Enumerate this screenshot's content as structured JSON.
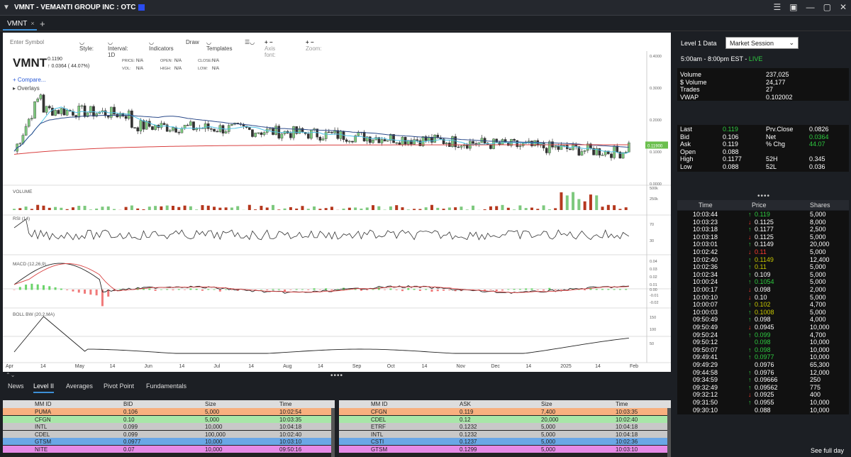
{
  "window": {
    "title": "VMNT - VEMANTI GROUP INC : OTC",
    "swatch_color": "#2a4cf0",
    "controls": [
      "☰",
      "▣",
      "—",
      "▢",
      "✕"
    ]
  },
  "tabs": [
    {
      "label": "VMNT",
      "close": "×"
    }
  ],
  "add_tab": "+",
  "toolbar": {
    "symbol_placeholder": "Enter Symbol",
    "style": "Style:",
    "interval": "Interval: 1D",
    "indicators": "Indicators",
    "draw": "Draw",
    "templates": "Templates",
    "axis_font": "Axis font:",
    "zoom": "Zoom:"
  },
  "quote": {
    "symbol": "VMNT",
    "last": "0.1190",
    "change": "0.0364 ( 44.07%)",
    "fields": [
      {
        "k": "PRICE:",
        "v": "N/A"
      },
      {
        "k": "OPEN:",
        "v": "N/A"
      },
      {
        "k": "CLOSE:",
        "v": "N/A"
      },
      {
        "k": "VOL:",
        "v": "N/A"
      },
      {
        "k": "HIGH:",
        "v": "N/A"
      },
      {
        "k": "LOW:",
        "v": "N/A"
      }
    ],
    "compare": "Compare...",
    "overlays": "Overlays",
    "price_tag": "0.11900"
  },
  "price_axis": [
    "0.4000",
    "0.3000",
    "0.2000",
    "0.1000",
    "0.0000"
  ],
  "panels": [
    {
      "label": "VOLUME",
      "ticks": [
        "500k",
        "250k"
      ]
    },
    {
      "label": "RSI (14)",
      "ticks": [
        "70",
        "30"
      ]
    },
    {
      "label": "MACD (12,26,9)",
      "ticks": [
        "0.04",
        "0.03",
        "0.02",
        "0.01",
        "0.00",
        "-0.01",
        "-0.02"
      ]
    },
    {
      "label": "BOLL BW (20,2,MA)",
      "ticks": [
        "150",
        "100",
        "50"
      ]
    }
  ],
  "x_axis": [
    "Apr",
    "14",
    "May",
    "14",
    "Jun",
    "14",
    "Jul",
    "14",
    "Aug",
    "14",
    "Sep",
    "Oct",
    "14",
    "Nov",
    "Dec",
    "14",
    "2025",
    "14",
    "Feb"
  ],
  "chart_data": {
    "type": "candlestick",
    "symbol": "VMNT",
    "series": [
      "price",
      "ma_short",
      "ma_long",
      "ma_flat",
      "volume",
      "rsi",
      "macd",
      "boll_bw"
    ],
    "y_range": [
      0.0,
      0.4
    ]
  },
  "level1": {
    "label": "Level 1 Data",
    "session_select": "Market Session",
    "hours": "5:00am - 8:00pm EST - ",
    "live": "LIVE",
    "stats": [
      {
        "k": "Volume",
        "v": "237,025"
      },
      {
        "k": "$ Volume",
        "v": "24,177"
      },
      {
        "k": " Trades",
        "v": "27"
      },
      {
        "k": " VWAP",
        "v": "0.102002"
      }
    ],
    "quote_left": [
      {
        "k": "Last",
        "v": "0.119",
        "c": "#2ecc40"
      },
      {
        "k": "Bid",
        "v": "0.106",
        "c": "#fff"
      },
      {
        "k": "Ask",
        "v": "0.119",
        "c": "#fff"
      },
      {
        "k": "Open",
        "v": "0.088",
        "c": "#fff"
      },
      {
        "k": "High",
        "v": "0.1177",
        "c": "#fff"
      },
      {
        "k": "Low",
        "v": "0.088",
        "c": "#fff"
      }
    ],
    "quote_right": [
      {
        "k": "Prv.Close",
        "v": "0.0826",
        "c": "#fff"
      },
      {
        "k": "Net",
        "v": "0.0364",
        "c": "#2ecc40"
      },
      {
        "k": "% Chg",
        "v": "44.07",
        "c": "#2ecc40"
      },
      {
        "k": "",
        "v": "",
        "c": "#fff"
      },
      {
        "k": "52H",
        "v": "0.345",
        "c": "#fff"
      },
      {
        "k": "52L",
        "v": "0.036",
        "c": "#fff"
      }
    ]
  },
  "time_sales": {
    "headers": [
      "Time",
      "Price",
      "Shares"
    ],
    "see_full": "See full day",
    "rows": [
      [
        "10:03:44",
        "↑",
        "0.119",
        "5,000",
        "#2ecc40"
      ],
      [
        "10:03:23",
        "↓",
        "0.1125",
        "8,000",
        "#fff"
      ],
      [
        "10:03:18",
        "↑",
        "0.1177",
        "2,500",
        "#fff"
      ],
      [
        "10:03:18",
        "↓",
        "0.1125",
        "5,000",
        "#fff"
      ],
      [
        "10:03:01",
        "↑",
        "0.1149",
        "20,000",
        "#fff"
      ],
      [
        "10:02:42",
        "↓",
        "0.11",
        "5,000",
        "#ff3b30"
      ],
      [
        "10:02:40",
        "↑",
        "0.1149",
        "12,400",
        "#c8c800"
      ],
      [
        "10:02:36",
        "↑",
        "0.11",
        "5,000",
        "#c8c800"
      ],
      [
        "10:02:34",
        "↑",
        "0.109",
        "5,000",
        "#fff"
      ],
      [
        "10:00:24",
        "↑",
        "0.1054",
        "5,000",
        "#2ecc40"
      ],
      [
        "10:00:17",
        "↓",
        "0.098",
        "2,000",
        "#fff"
      ],
      [
        "10:00:10",
        "↓",
        "0.10",
        "5,000",
        "#fff"
      ],
      [
        "10:00:07",
        "↑",
        "0.102",
        "4,700",
        "#c8c800"
      ],
      [
        "10:00:03",
        "↑",
        "0.1008",
        "5,000",
        "#c8c800"
      ],
      [
        "09:50:49",
        "↑",
        "0.098",
        "4,000",
        "#fff"
      ],
      [
        "09:50:49",
        "↓",
        "0.0945",
        "10,000",
        "#fff"
      ],
      [
        "09:50:24",
        "↑",
        "0.099",
        "4,700",
        "#2ecc40"
      ],
      [
        "09:50:12",
        "",
        "0.098",
        "10,000",
        "#2ecc40"
      ],
      [
        "09:50:07",
        "↑",
        "0.098",
        "10,000",
        "#2ecc40"
      ],
      [
        "09:49:41",
        "↑",
        "0.0977",
        "10,000",
        "#2ecc40"
      ],
      [
        "09:49:29",
        "",
        "0.0976",
        "65,300",
        "#fff"
      ],
      [
        "09:44:58",
        "↑",
        "0.0976",
        "12,000",
        "#fff"
      ],
      [
        "09:34:59",
        "↑",
        "0.09666",
        "250",
        "#fff"
      ],
      [
        "09:32:49",
        "↑",
        "0.09562",
        "775",
        "#fff"
      ],
      [
        "09:32:12",
        "↓",
        "0.0925",
        "400",
        "#fff"
      ],
      [
        "09:31:50",
        "↑",
        "0.0955",
        "10,000",
        "#fff"
      ],
      [
        "09:30:10",
        "",
        "0.088",
        "10,000",
        "#fff"
      ]
    ]
  },
  "bottom_tabs": [
    "News",
    "Level II",
    "Averages",
    "Pivot Point",
    "Fundamentals"
  ],
  "level2_bid": {
    "headers": [
      "MM ID",
      "BID",
      "Size",
      "Time"
    ],
    "rows": [
      [
        "PUMA",
        "0.106",
        "5,000",
        "10:02:54",
        "#f8b07f"
      ],
      [
        "CFGN",
        "0.10",
        "5,000",
        "10:03:35",
        "#a8e6a8"
      ],
      [
        "INTL",
        "0.099",
        "10,000",
        "10:04:18",
        "#c8c8c8"
      ],
      [
        "CDEL",
        "0.099",
        "100,000",
        "10:02:40",
        "#c8c8c8"
      ],
      [
        "GTSM",
        "0.0977",
        "10,000",
        "10:03:10",
        "#6aa7e6"
      ],
      [
        "NITE",
        "0.07",
        "10,000",
        "09:50:16",
        "#e68ae6"
      ]
    ]
  },
  "level2_ask": {
    "headers": [
      "MM ID",
      "ASK",
      "Size",
      "Time"
    ],
    "rows": [
      [
        "CFGN",
        "0.119",
        "7,400",
        "10:03:35",
        "#f8b07f"
      ],
      [
        "CDEL",
        "0.12",
        "20,000",
        "10:02:40",
        "#a8e6a8"
      ],
      [
        "ETRF",
        "0.1232",
        "5,000",
        "10:04:18",
        "#c8c8c8"
      ],
      [
        "INTL",
        "0.1232",
        "5,000",
        "10:04:18",
        "#c8c8c8"
      ],
      [
        "CSTI",
        "0.1237",
        "5,000",
        "10:02:36",
        "#6aa7e6"
      ],
      [
        "GTSM",
        "0.1299",
        "5,000",
        "10:03:10",
        "#e68ae6"
      ]
    ]
  }
}
